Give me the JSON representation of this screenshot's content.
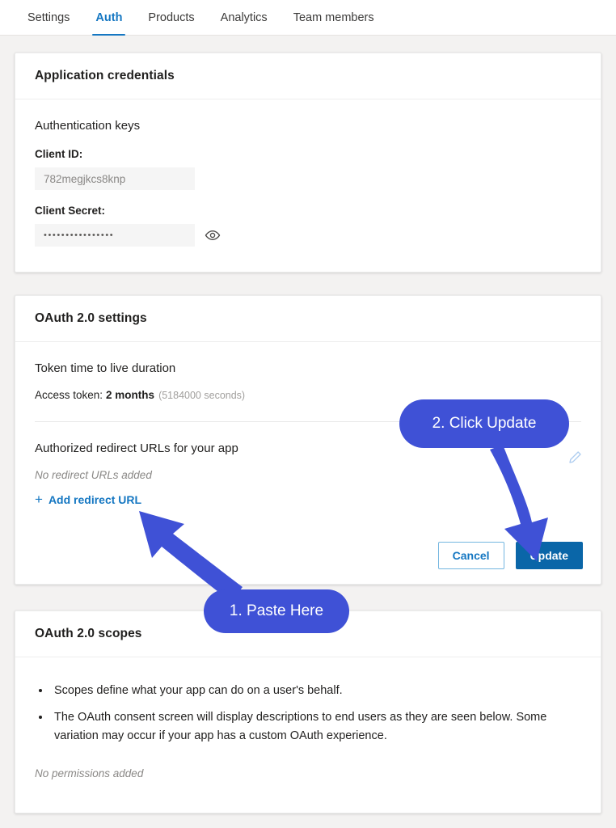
{
  "tabs": [
    {
      "label": "Settings",
      "active": false
    },
    {
      "label": "Auth",
      "active": true
    },
    {
      "label": "Products",
      "active": false
    },
    {
      "label": "Analytics",
      "active": false
    },
    {
      "label": "Team members",
      "active": false
    }
  ],
  "credentials_card": {
    "title": "Application credentials",
    "section_title": "Authentication keys",
    "client_id_label": "Client ID:",
    "client_id_value": "782megjkcs8knp",
    "client_secret_label": "Client Secret:",
    "client_secret_masked": "••••••••••••••••",
    "reveal_icon": "eye-icon"
  },
  "oauth_card": {
    "title": "OAuth 2.0 settings",
    "ttl_heading": "Token time to live duration",
    "access_token_label": "Access token:",
    "access_token_value": "2 months",
    "access_token_seconds": "(5184000 seconds)",
    "redirect_heading": "Authorized redirect URLs for your app",
    "redirect_empty": "No redirect URLs added",
    "add_redirect_label": "Add redirect URL",
    "add_icon": "plus-icon",
    "edit_icon": "pencil-icon",
    "cancel_label": "Cancel",
    "update_label": "Update"
  },
  "scopes_card": {
    "title": "OAuth 2.0 scopes",
    "bullets": [
      "Scopes define what your app can do on a user's behalf.",
      "The OAuth consent screen will display descriptions to end users as they are seen below. Some variation may occur if your app has a custom OAuth experience."
    ],
    "no_permissions": "No permissions added"
  },
  "annotations": {
    "step1_label": "1. Paste Here",
    "step2_label": "2. Click Update",
    "color": "#3f51d6"
  },
  "colors": {
    "page_background": "#f3f2f1",
    "card_background": "#ffffff",
    "accent_link": "#1577c2",
    "primary_button": "#0a66a8",
    "annotation_blue": "#3f51d6",
    "muted_text": "#8a8886"
  }
}
